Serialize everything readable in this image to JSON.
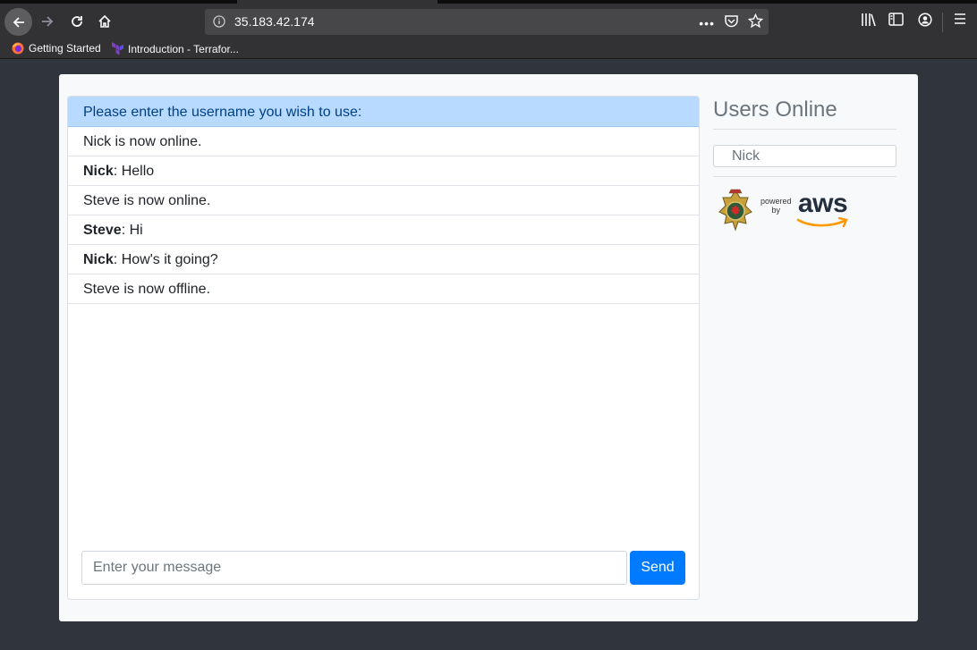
{
  "browser": {
    "url": "35.183.42.174",
    "bookmarks": [
      {
        "label": "Getting Started",
        "icon": "firefox-icon"
      },
      {
        "label": "Introduction - Terrafor...",
        "icon": "terraform-icon"
      }
    ]
  },
  "chat": {
    "header": "Please enter the username you wish to use:",
    "messages": [
      {
        "user": "",
        "text": "Nick is now online."
      },
      {
        "user": "Nick",
        "text": ": Hello"
      },
      {
        "user": "",
        "text": "Steve is now online."
      },
      {
        "user": "Steve",
        "text": ": Hi"
      },
      {
        "user": "Nick",
        "text": ": How's it going?"
      },
      {
        "user": "",
        "text": "Steve is now offline."
      }
    ],
    "input_placeholder": "Enter your message",
    "send_label": "Send"
  },
  "sidebar": {
    "title": "Users Online",
    "users": [
      "Nick"
    ],
    "powered_by": [
      "powered",
      "by"
    ],
    "aws_logo_text": "aws"
  },
  "colors": {
    "header_bg": "#b8daff",
    "send_button": "#007bff",
    "page_bg": "#2f343d"
  }
}
